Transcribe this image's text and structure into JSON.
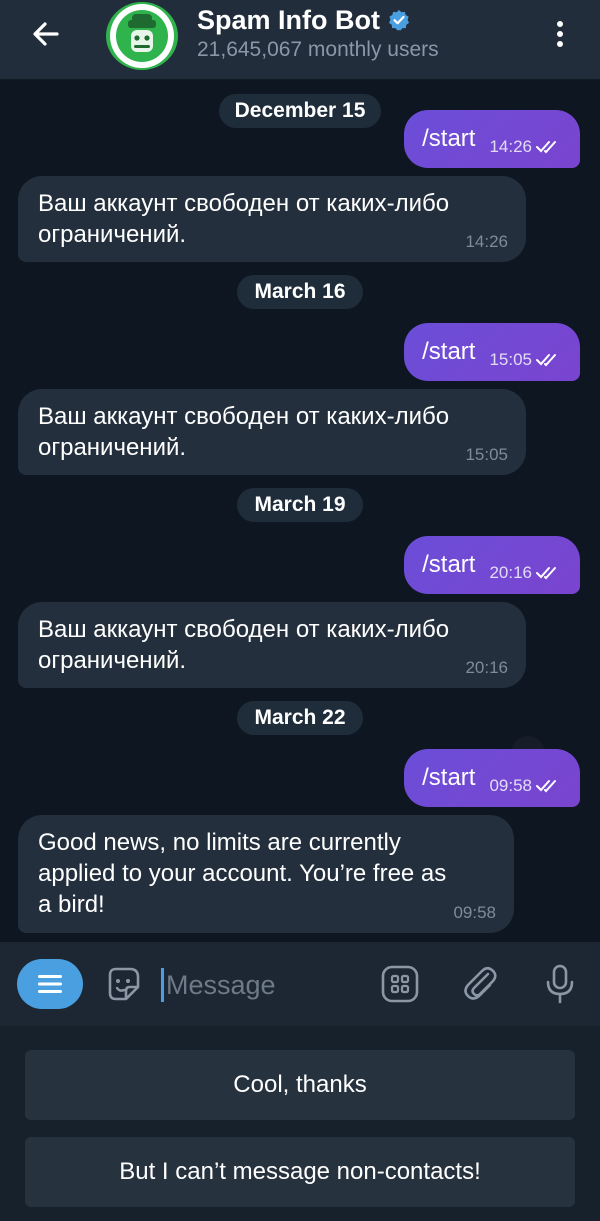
{
  "header": {
    "back_icon": "arrow-left-icon",
    "avatar_icon": "bot-ranger-icon",
    "title": "Spam Info Bot",
    "verified_icon": "verified-badge-icon",
    "subtitle": "21,645,067 monthly users",
    "menu_icon": "more-vertical-icon"
  },
  "chat": {
    "dates": [
      "December 15",
      "March 16",
      "March 19",
      "March 22"
    ],
    "outgoing": [
      {
        "text": "/start",
        "time": "14:26"
      },
      {
        "text": "/start",
        "time": "15:05"
      },
      {
        "text": "/start",
        "time": "20:16"
      },
      {
        "text": "/start",
        "time": "09:58"
      }
    ],
    "incoming": [
      {
        "line1": "Ваш аккаунт свободен от каких-либо",
        "line2": "ограничений.",
        "time": "14:26"
      },
      {
        "line1": "Ваш аккаунт свободен от каких-либо",
        "line2": "ограничений.",
        "time": "15:05"
      },
      {
        "line1": "Ваш аккаунт свободен от каких-либо",
        "line2": "ограничений.",
        "time": "20:16"
      },
      {
        "line1": "Good news, no limits are currently",
        "line2": "applied to your account. You’re free as",
        "line3": "a bird!",
        "time": "09:58"
      }
    ],
    "read_icon": "double-check-icon"
  },
  "input_bar": {
    "menu_icon": "bot-menu-icon",
    "sticker_icon": "sticker-icon",
    "placeholder": "Message",
    "commands_icon": "commands-grid-icon",
    "attach_icon": "paperclip-icon",
    "mic_icon": "microphone-icon"
  },
  "keyboard": {
    "buttons": [
      "Cool, thanks",
      "But I can’t message non-contacts!"
    ]
  },
  "colors": {
    "header_bg": "#212d3b",
    "chat_bg": "#0e1621",
    "outgoing_bubble": "#6b4ed8",
    "incoming_bubble": "#232f3c",
    "accent": "#4a9fe0",
    "verified": "#4a9fe0"
  }
}
